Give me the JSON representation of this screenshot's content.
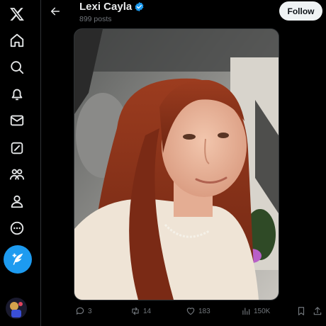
{
  "profile": {
    "name": "Lexi Cayla",
    "posts_count": "899 posts",
    "follow_label": "Follow"
  },
  "sidebar": {
    "items": [
      {
        "icon": "x-logo-icon"
      },
      {
        "icon": "home-icon"
      },
      {
        "icon": "search-icon"
      },
      {
        "icon": "bell-icon"
      },
      {
        "icon": "mail-icon"
      },
      {
        "icon": "grok-icon"
      },
      {
        "icon": "communities-icon"
      },
      {
        "icon": "profile-icon"
      },
      {
        "icon": "more-icon"
      }
    ],
    "post_button_icon": "compose-icon"
  },
  "post": {
    "replies": "3",
    "reposts": "14",
    "likes": "183",
    "views": "150K"
  },
  "colors": {
    "background": "#000000",
    "accent": "#1d9bf0",
    "text": "#e7e9ea",
    "muted": "#71767b",
    "follow_bg": "#eff3f4"
  }
}
